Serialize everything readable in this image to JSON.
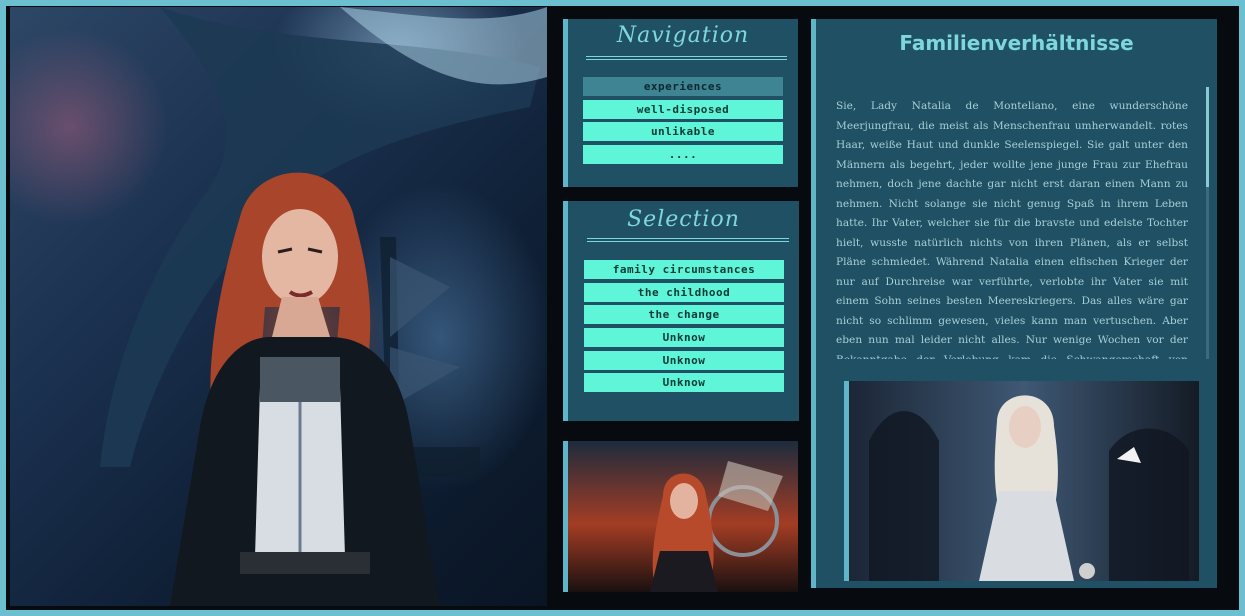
{
  "navigation": {
    "title": "Navigation",
    "items": [
      {
        "label": "experiences",
        "active": true
      },
      {
        "label": "well-disposed",
        "active": false
      },
      {
        "label": "unlikable",
        "active": false
      },
      {
        "label": "....",
        "active": false
      }
    ]
  },
  "selection": {
    "title": "Selection",
    "items": [
      {
        "label": "family circumstances"
      },
      {
        "label": "the childhood"
      },
      {
        "label": "the change"
      },
      {
        "label": "Unknow"
      },
      {
        "label": "Unknow"
      },
      {
        "label": "Unknow"
      }
    ]
  },
  "content": {
    "title": "Familienverhältnisse",
    "text": "Sie, Lady Natalia de Monteliano, eine wunderschöne Meerjungfrau, die meist als Menschenfrau umherwandelt. rotes Haar, weiße Haut und dunkle Seelenspiegel. Sie galt unter den Männern als begehrt, jeder wollte jene junge Frau zur Ehefrau nehmen, doch jene dachte gar nicht erst daran einen Mann zu nehmen. Nicht solange sie nicht genug Spaß in ihrem Leben hatte. Ihr Vater, welcher sie für die bravste und edelste Tochter hielt, wusste natürlich nichts von ihren Plänen, als er selbst Pläne schmiedet. Während Natalia einen elfischen Krieger der nur auf Durchreise war verführte, verlobte ihr Vater sie mit einem Sohn seines besten Meereskriegers. Das alles wäre gar nicht so schlimm gewesen, vieles kann man vertuschen. Aber eben nun mal leider nicht alles. Nur wenige Wochen vor der Bekanntgabe der Verlobung kam die Schwangerschaft von Natalia"
  },
  "colors": {
    "accent": "#5ef5d8",
    "panel": "#1f5064",
    "frame": "#6bbfcf",
    "title": "#7fd7de"
  }
}
